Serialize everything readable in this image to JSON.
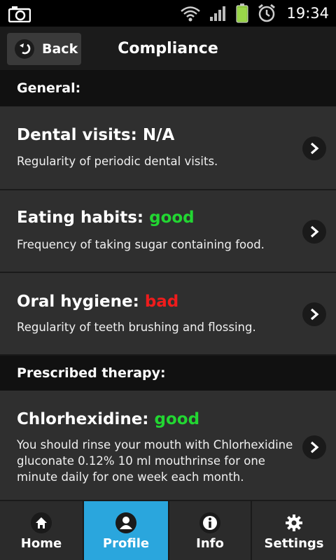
{
  "status": {
    "time": "19:34"
  },
  "header": {
    "back_label": "Back",
    "title": "Compliance"
  },
  "sections": {
    "general": "General:",
    "therapy": "Prescribed therapy:"
  },
  "rows": [
    {
      "label": "Dental visits:",
      "value": "N/A",
      "status": "neutral",
      "description": "Regularity of periodic dental visits."
    },
    {
      "label": "Eating habits:",
      "value": "good",
      "status": "good",
      "description": "Frequency of taking sugar containing food."
    },
    {
      "label": "Oral hygiene:",
      "value": "bad",
      "status": "bad",
      "description": "Regularity of teeth brushing and flossing."
    },
    {
      "label": "Chlorhexidine:",
      "value": "good",
      "status": "good",
      "description_lines": [
        "You should rinse your mouth with Chlorhexidine",
        "gluconate 0.12% 10 ml mouthrinse for one",
        "minute daily for one week each month."
      ]
    }
  ],
  "nav": [
    {
      "label": "Home",
      "icon": "home-icon",
      "active": false
    },
    {
      "label": "Profile",
      "icon": "profile-icon",
      "active": true
    },
    {
      "label": "Info",
      "icon": "info-icon",
      "active": false
    },
    {
      "label": "Settings",
      "icon": "settings-icon",
      "active": false
    }
  ],
  "colors": {
    "good": "#22d632",
    "bad": "#ee1c1c",
    "active_tab": "#2aa6dd"
  }
}
